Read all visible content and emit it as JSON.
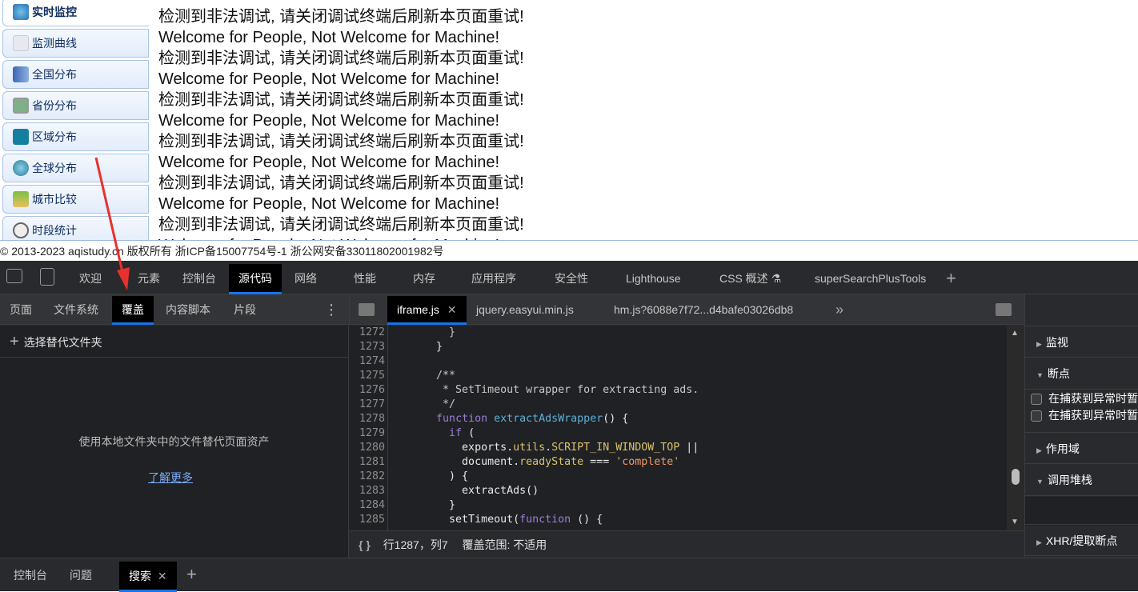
{
  "sidebar": {
    "items": [
      {
        "label": "实时监控",
        "icon": "monitor-icon",
        "active": true
      },
      {
        "label": "监测曲线",
        "icon": "line-chart-icon"
      },
      {
        "label": "全国分布",
        "icon": "china-map-icon"
      },
      {
        "label": "省份分布",
        "icon": "province-map-icon"
      },
      {
        "label": "区域分布",
        "icon": "region-map-icon"
      },
      {
        "label": "全球分布",
        "icon": "globe-icon"
      },
      {
        "label": "城市比较",
        "icon": "scale-icon"
      },
      {
        "label": "时段统计",
        "icon": "clock-icon"
      }
    ]
  },
  "messages": [
    "检测到非法调试, 请关闭调试终端后刷新本页面重试!",
    "Welcome for People, Not Welcome for Machine!",
    "检测到非法调试, 请关闭调试终端后刷新本页面重试!",
    "Welcome for People, Not Welcome for Machine!",
    "检测到非法调试, 请关闭调试终端后刷新本页面重试!",
    "Welcome for People, Not Welcome for Machine!",
    "检测到非法调试, 请关闭调试终端后刷新本页面重试!",
    "Welcome for People, Not Welcome for Machine!",
    "检测到非法调试, 请关闭调试终端后刷新本页面重试!",
    "Welcome for People, Not Welcome for Machine!",
    "检测到非法调试, 请关闭调试终端后刷新本页面重试!",
    "Welcome for People, Not Welcome for Machine!"
  ],
  "footer": "© 2013-2023 aqistudy.cn 版权所有 浙ICP备15007754号-1 浙公网安备33011802001982号",
  "devtools": {
    "main_tabs": [
      "欢迎",
      "元素",
      "控制台",
      "源代码",
      "网络",
      "性能",
      "内存",
      "应用程序",
      "安全性",
      "Lighthouse",
      "CSS 概述 ⚗",
      "superSearchPlusTools"
    ],
    "active_main_tab": "源代码",
    "nav_tabs": [
      "页面",
      "文件系统",
      "覆盖",
      "内容脚本",
      "片段"
    ],
    "active_nav_tab": "覆盖",
    "overrides": {
      "add_folder": "选择替代文件夹",
      "description": "使用本地文件夹中的文件替代页面资产",
      "learn_more": "了解更多"
    },
    "file_tabs": [
      "iframe.js",
      "jquery.easyui.min.js",
      "hm.js?6088e7f72...d4bafe03026db8"
    ],
    "active_file": "iframe.js",
    "line_numbers": [
      "1272",
      "1273",
      "1274",
      "1275",
      "1276",
      "1277",
      "1278",
      "1279",
      "1280",
      "1281",
      "1282",
      "1283",
      "1284",
      "1285"
    ],
    "status": {
      "position": "行1287，列7",
      "coverage": "覆盖范围: 不适用"
    },
    "debugger": {
      "sections": [
        "监视",
        "断点",
        "作用域",
        "调用堆栈",
        "XHR/提取断点"
      ],
      "breakpoint_options": [
        "在捕获到异常时暂停",
        "在捕获到异常时暂停"
      ]
    },
    "drawer_tabs": [
      "控制台",
      "问题",
      "搜索"
    ],
    "active_drawer_tab": "搜索"
  },
  "colors": {
    "accent": "#1a73e8",
    "annotation_arrow": "#e8312f"
  }
}
